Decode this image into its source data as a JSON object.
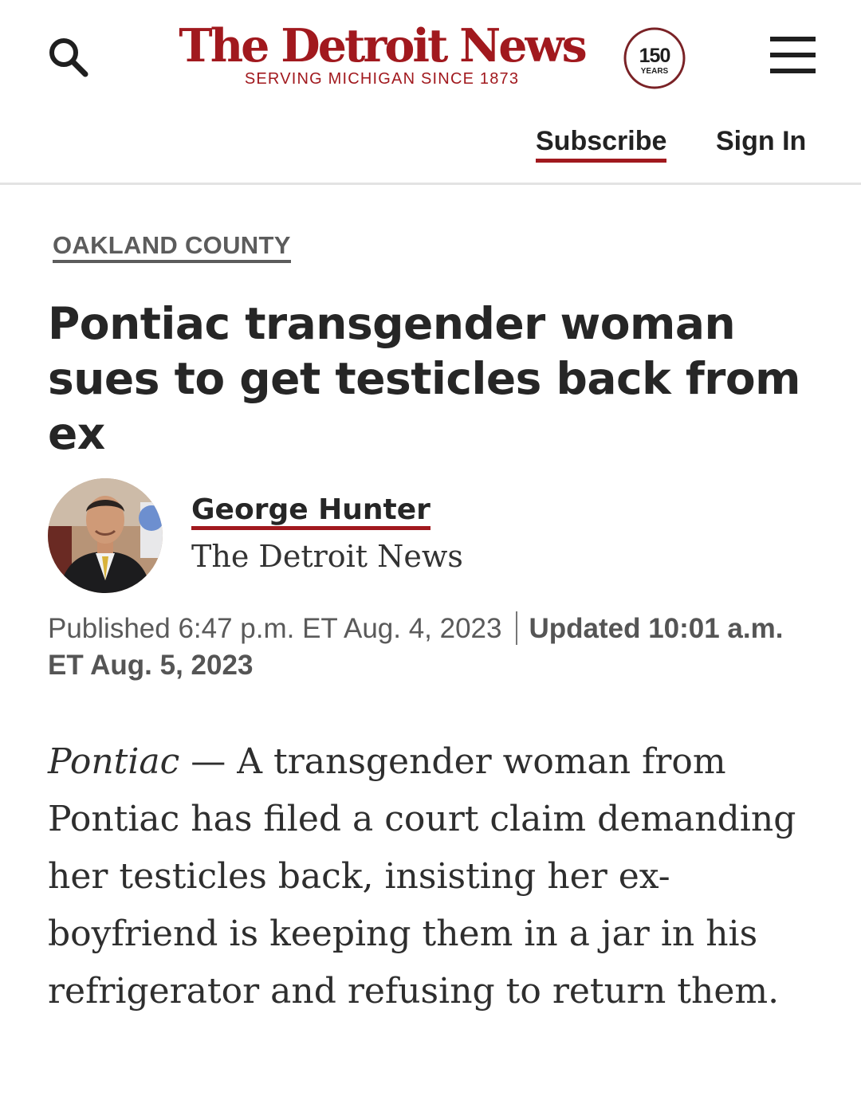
{
  "header": {
    "brand_name": "The Detroit News",
    "tagline": "SERVING MICHIGAN SINCE 1873",
    "badge": {
      "number": "150",
      "label": "YEARS"
    },
    "subscribe_label": "Subscribe",
    "signin_label": "Sign In",
    "icons": {
      "search": "search-icon",
      "menu": "hamburger-menu-icon"
    },
    "brand_color": "#a1191e"
  },
  "article": {
    "section": "OAKLAND COUNTY",
    "headline": "Pontiac transgender woman sues to get testicles back from ex",
    "author": {
      "name": "George Hunter",
      "organization": "The Detroit News"
    },
    "published": "Published 6:47 p.m. ET Aug. 4, 2023",
    "updated": "Updated 10:01 a.m. ET Aug. 5, 2023",
    "body": {
      "dateline_place": "Pontiac",
      "dateline_dash": " — ",
      "text": "A transgender woman from Pontiac has filed a court claim demanding her testicles back, insisting her ex-boyfriend is keeping them in a jar in his refrigerator and refusing to return them."
    }
  }
}
